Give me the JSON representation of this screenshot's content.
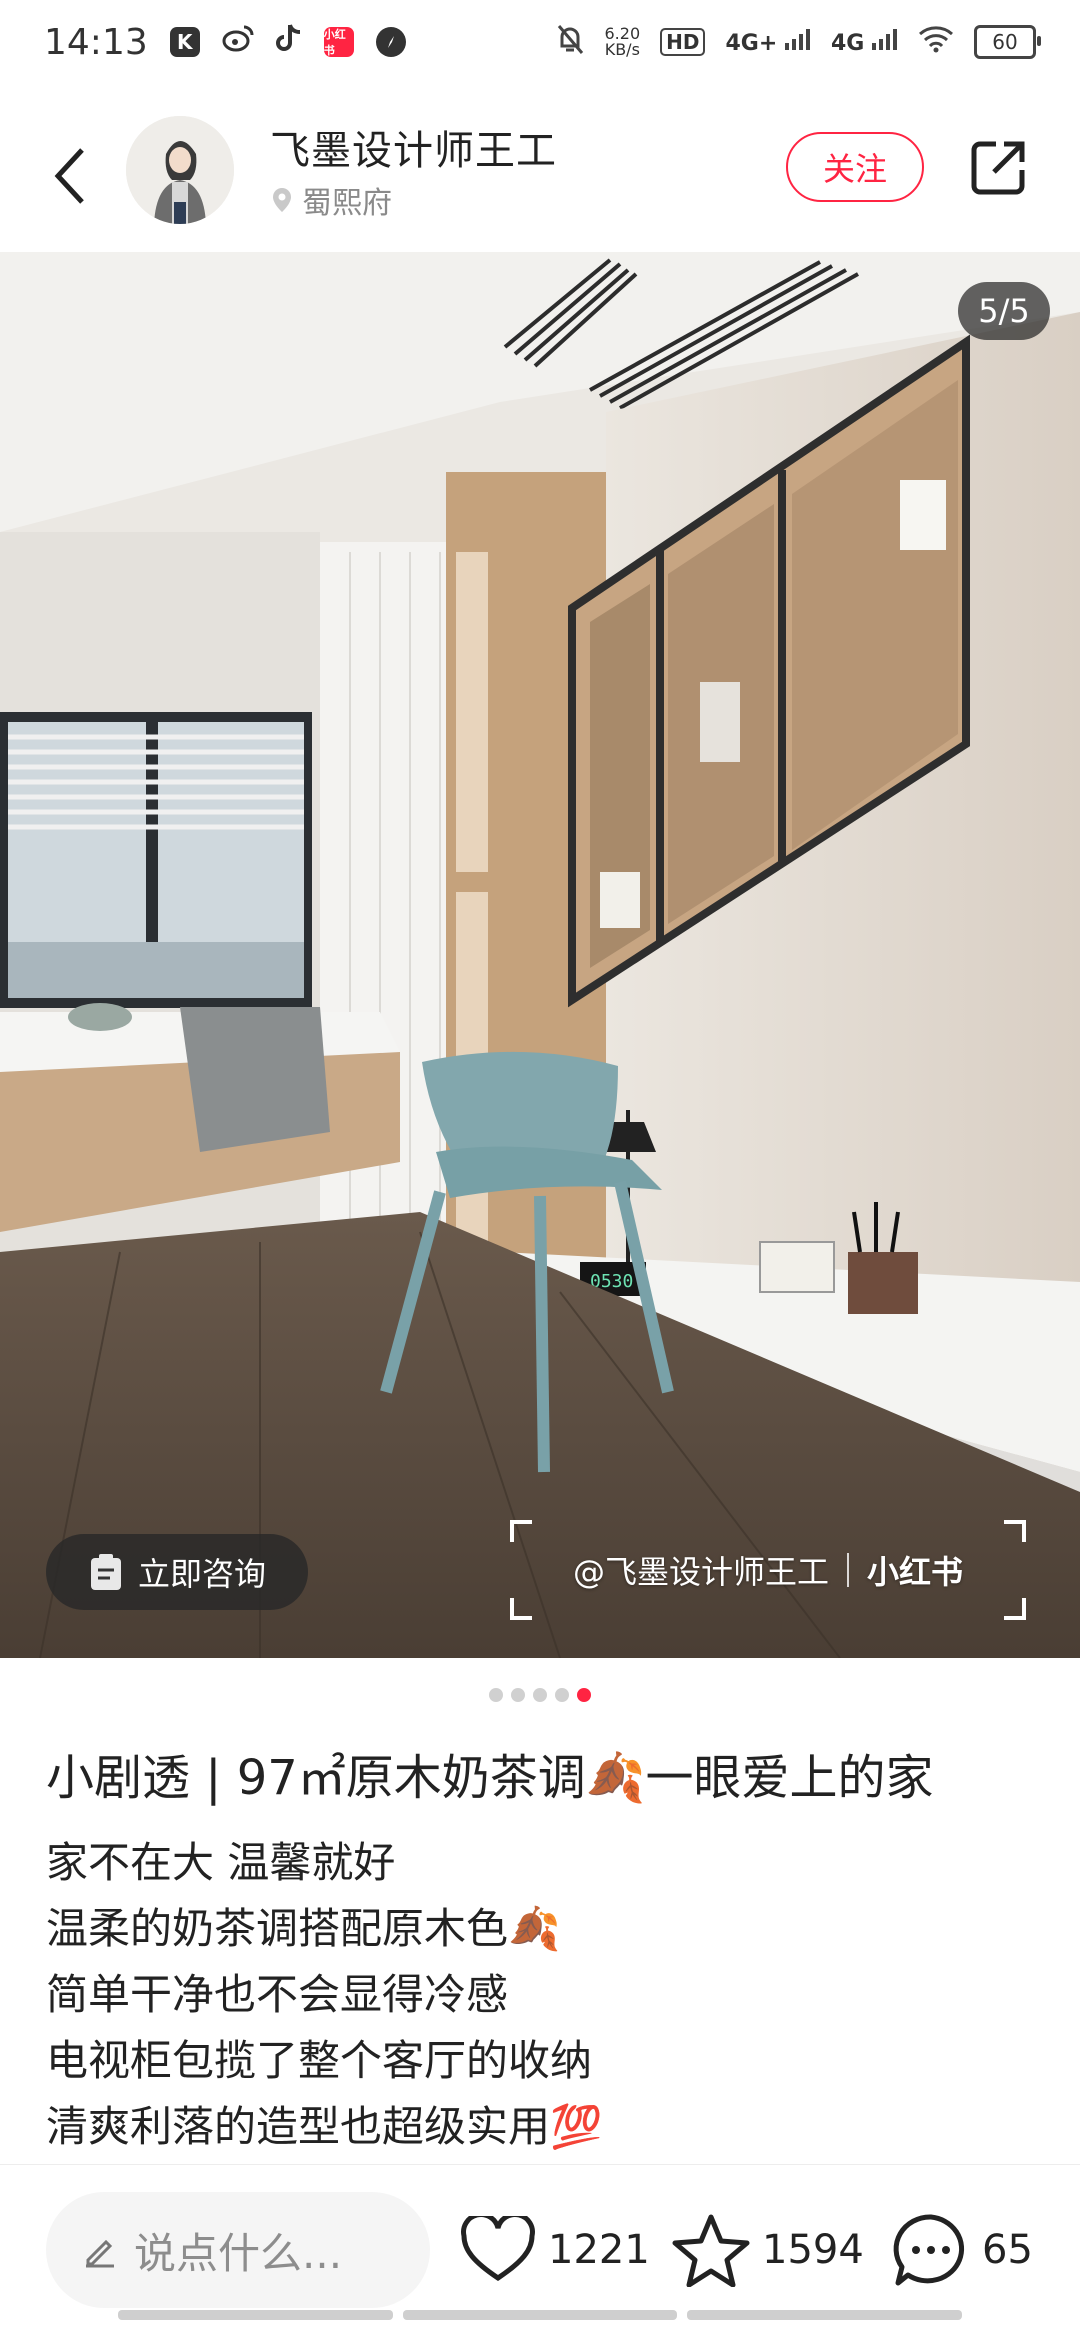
{
  "status_bar": {
    "time": "14:13",
    "net_speed_value": "6.20",
    "net_speed_unit": "KB/s",
    "hd_label": "HD",
    "signal_1": "4G+",
    "signal_2": "4G",
    "battery": "60",
    "app_icons": [
      "K",
      "weibo",
      "tiktok",
      "小红书",
      "compass"
    ]
  },
  "header": {
    "author_name": "飞墨设计师王工",
    "location": "蜀熙府",
    "follow_label": "关注",
    "brand_color": "#ff2442"
  },
  "photo": {
    "page_counter": "5/5",
    "consult_label": "立即咨询",
    "watermark_author": "@飞墨设计师王工",
    "watermark_brand": "小红书",
    "clock_digits": "0530"
  },
  "carousel": {
    "total": 5,
    "active_index": 4
  },
  "post": {
    "title": "小剧透 | 97㎡原木奶茶调🍂一眼爱上的家",
    "lines": [
      "家不在大 温馨就好",
      "温柔的奶茶调搭配原木色🍂",
      "简单干净也不会显得冷感",
      "电视柜包揽了整个客厅的收纳",
      "清爽利落的造型也超级实用💯"
    ]
  },
  "bottom_bar": {
    "comment_placeholder": "说点什么...",
    "likes": "1221",
    "favorites": "1594",
    "comments": "65"
  }
}
